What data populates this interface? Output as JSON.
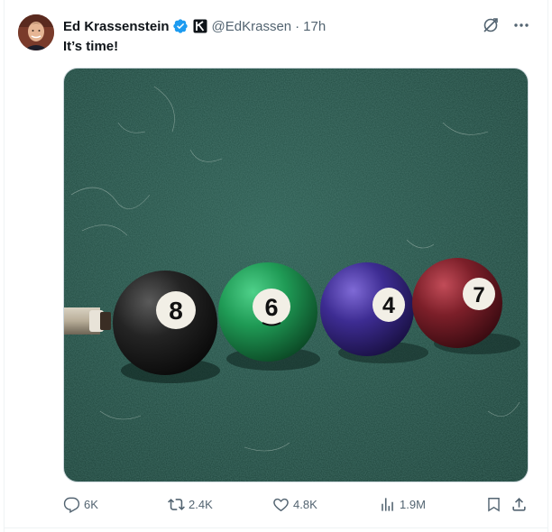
{
  "author": {
    "display_name": "Ed Krassenstein",
    "handle": "@EdKrassen",
    "separator": "·",
    "time": "17h",
    "verified": true
  },
  "tweet": {
    "text": "It’s time!"
  },
  "media": {
    "alt": "Pool balls numbered 8, 6, 4 and 7 lined up on green felt with a cue tip",
    "balls": [
      {
        "number": "8",
        "color": "#1c1c1c"
      },
      {
        "number": "6",
        "color": "#1d8f4e"
      },
      {
        "number": "4",
        "color": "#3b2a8a"
      },
      {
        "number": "7",
        "color": "#7a1c24"
      }
    ]
  },
  "actions": {
    "reply_count": "6K",
    "repost_count": "2.4K",
    "like_count": "4.8K",
    "view_count": "1.9M"
  },
  "icons": {
    "top": [
      "grok-icon",
      "more-icon"
    ],
    "bar": [
      "reply-icon",
      "repost-icon",
      "like-icon",
      "views-icon",
      "bookmark-icon",
      "share-icon"
    ]
  },
  "colors": {
    "text": "#0f1419",
    "muted": "#536471",
    "verified": "#1d9bf0",
    "felt": "#1f4a40"
  }
}
